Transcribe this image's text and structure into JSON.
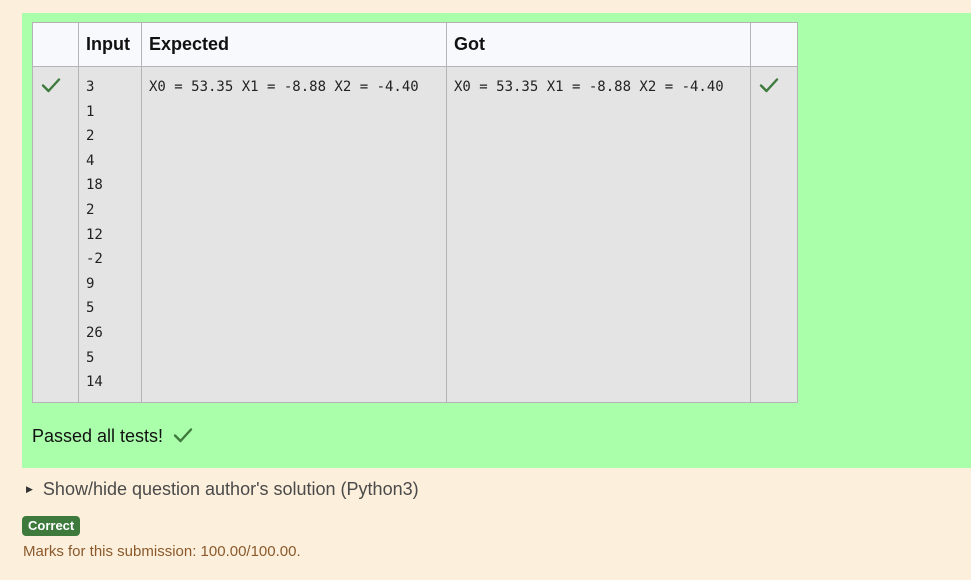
{
  "results_table": {
    "headers": {
      "status": "",
      "input": "Input",
      "expected": "Expected",
      "got": "Got",
      "status2": ""
    },
    "row": {
      "input_lines": [
        "3",
        "1",
        "2",
        "4",
        "18",
        "2",
        "12",
        "-2",
        "9",
        "5",
        "26",
        "5",
        "14"
      ],
      "expected": "X0 = 53.35 X1 = -8.88 X2 = -4.40",
      "got": "X0 = 53.35 X1 = -8.88 X2 = -4.40"
    }
  },
  "summary": {
    "text": "Passed all tests!"
  },
  "solution_toggle": {
    "label": "Show/hide question author's solution (Python3)"
  },
  "status_badge": {
    "label": "Correct"
  },
  "marks": {
    "text": "Marks for this submission: 100.00/100.00."
  },
  "colors": {
    "page_background": "#fcefdc",
    "panel_background": "#aaffaa",
    "check_color": "#3d7a3c",
    "badge_background": "#3d7a3c"
  },
  "icons": {
    "row_status_left": "check-icon",
    "row_status_right": "check-icon",
    "summary": "check-icon",
    "toggle": "triangle-right-icon"
  }
}
